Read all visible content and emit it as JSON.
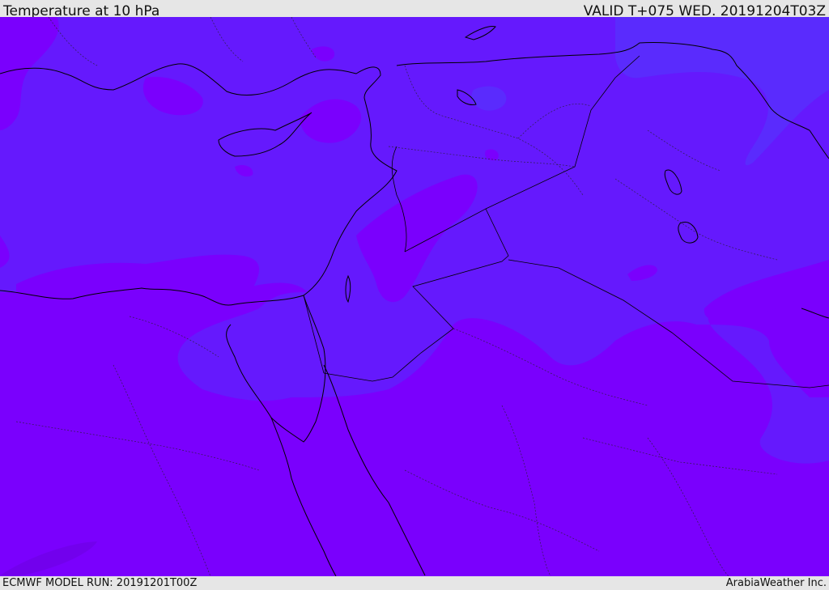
{
  "header": {
    "title": "Temperature at 10 hPa",
    "valid": "VALID T+075 WED. 20191204T03Z"
  },
  "footer": {
    "model_run": "ECMWF MODEL RUN: 20191201T00Z",
    "brand": "ArabiaWeather Inc."
  },
  "map": {
    "colors": {
      "warm_fill": "#7a00fd",
      "cool_fill": "#6519fd",
      "cooler_fill": "#5a2bfd",
      "coast": "#000000"
    }
  }
}
